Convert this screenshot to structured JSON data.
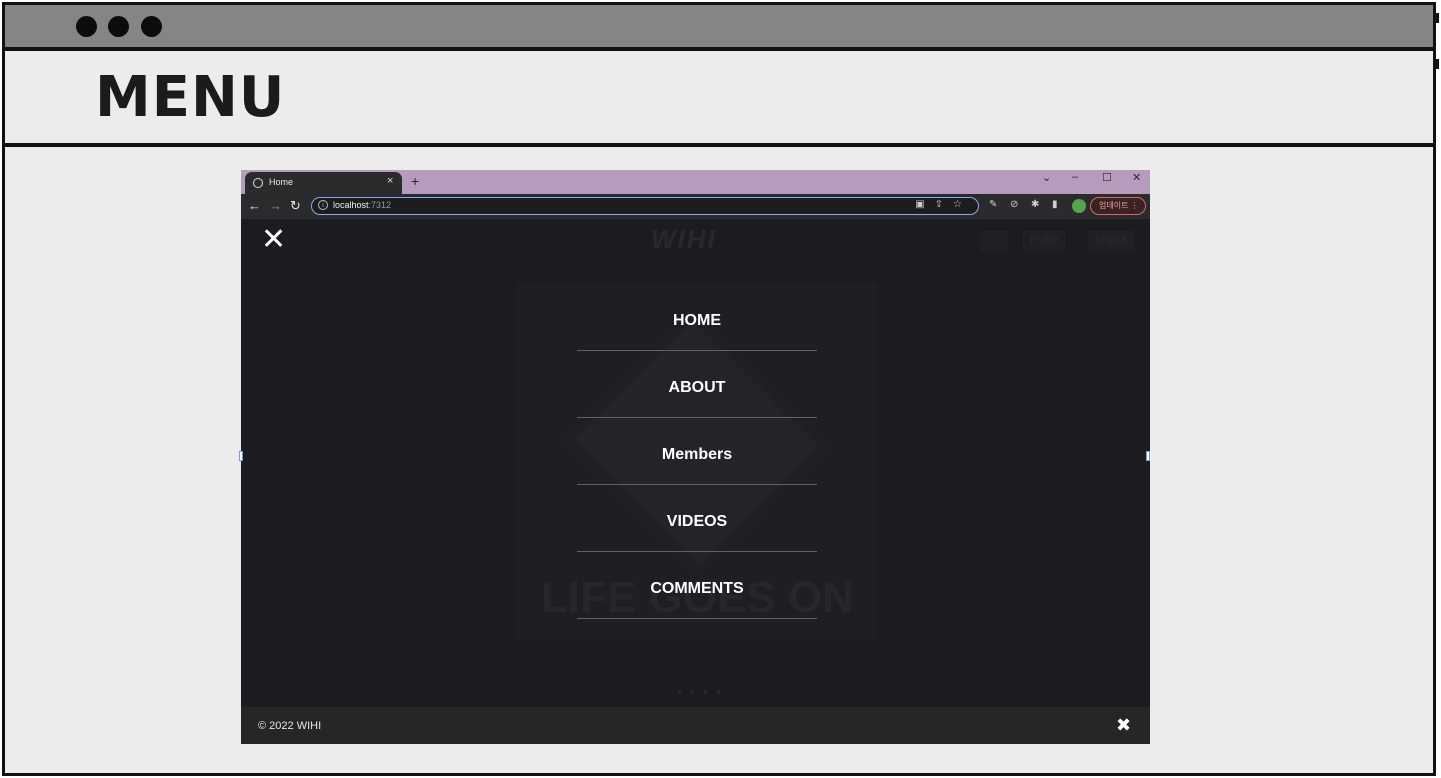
{
  "mock": {
    "title": "MENU"
  },
  "browser": {
    "tab_title": "Home",
    "tab_close": "×",
    "new_tab": "+",
    "window_controls": {
      "collapse": "⌄",
      "minimize": "–",
      "maximize": "☐",
      "close": "✕"
    },
    "nav": {
      "back": "←",
      "forward": "→",
      "reload": "↻"
    },
    "url_host": "localhost",
    "url_port": ":7312",
    "update_label": "업데이트 ⋮"
  },
  "page": {
    "background": {
      "logo": "WIHI",
      "buttons": [
        "",
        "Profile",
        "Logout"
      ],
      "album_title": "LIFE GOES ON"
    },
    "close_button": "✕",
    "menu_items": [
      "HOME",
      "ABOUT",
      "Members",
      "VIDEOS",
      "COMMENTS"
    ],
    "footer": {
      "copyright": "© 2022 WIHI",
      "tools_icon": "✖"
    }
  }
}
